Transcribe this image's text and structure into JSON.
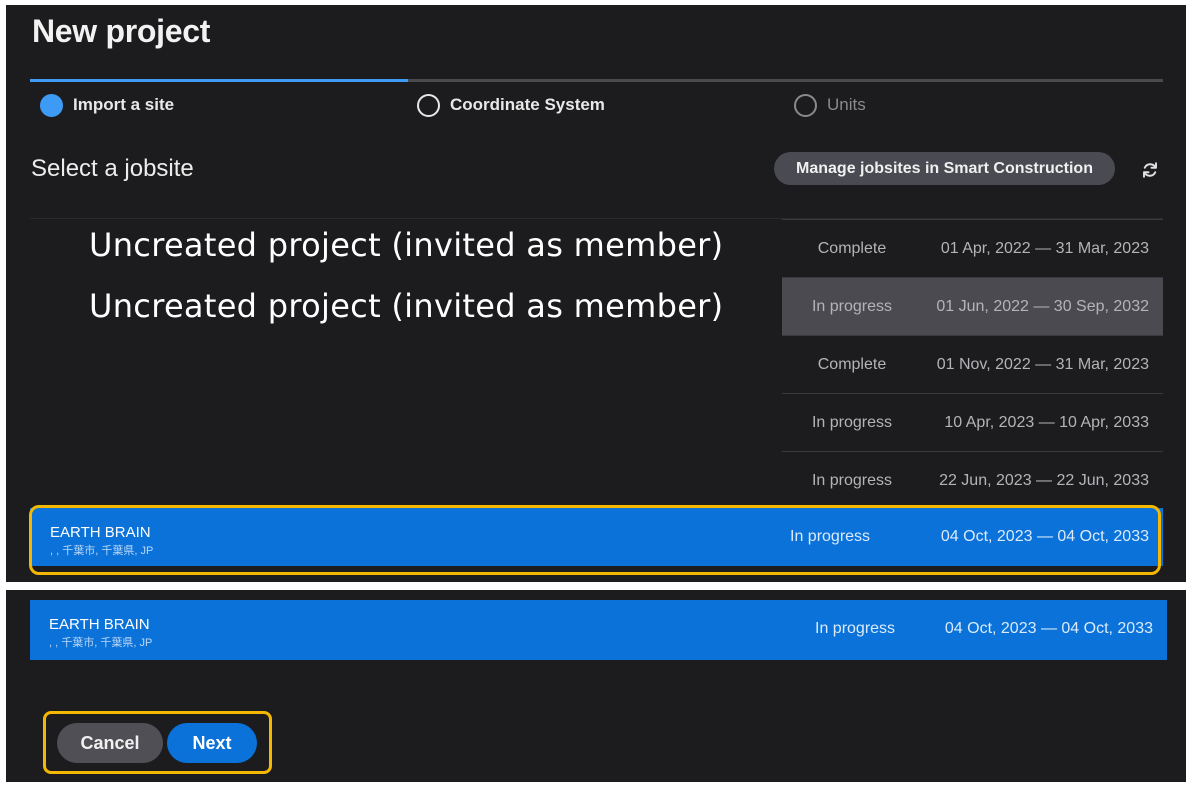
{
  "dialog": {
    "title": "New project"
  },
  "stepper": {
    "steps": [
      {
        "label": "Import a site",
        "state": "active"
      },
      {
        "label": "Coordinate System",
        "state": "pending"
      },
      {
        "label": "Units",
        "state": "disabled"
      }
    ]
  },
  "jobsite_section": {
    "title": "Select a jobsite",
    "manage_button_label": "Manage jobsites in Smart Construction",
    "refresh_icon": "refresh-icon"
  },
  "annotations": {
    "uncreated_1": "Uncreated project (invited as member)",
    "uncreated_2": "Uncreated project (invited as member)"
  },
  "jobsites": [
    {
      "status": "Complete",
      "dates": "01 Apr, 2022 — 31 Mar, 2023"
    },
    {
      "status": "In progress",
      "dates": "01 Jun, 2022 — 30 Sep, 2032"
    },
    {
      "status": "Complete",
      "dates": "01 Nov, 2022 — 31 Mar, 2023"
    },
    {
      "status": "In progress",
      "dates": "10 Apr, 2023 — 10 Apr, 2033"
    },
    {
      "status": "In progress",
      "dates": "22 Jun, 2023 — 22 Jun, 2033"
    }
  ],
  "selected_jobsite": {
    "name": "EARTH BRAIN",
    "address": ", , 千葉市, 千葉県, JP",
    "status": "In progress",
    "dates": "04 Oct, 2023 — 04 Oct, 2033"
  },
  "footer": {
    "cancel_label": "Cancel",
    "next_label": "Next"
  },
  "colors": {
    "background": "#1c1c1e",
    "accent": "#0a72d8",
    "stepper_accent": "#3d9bf5",
    "highlight": "#f5b800"
  }
}
